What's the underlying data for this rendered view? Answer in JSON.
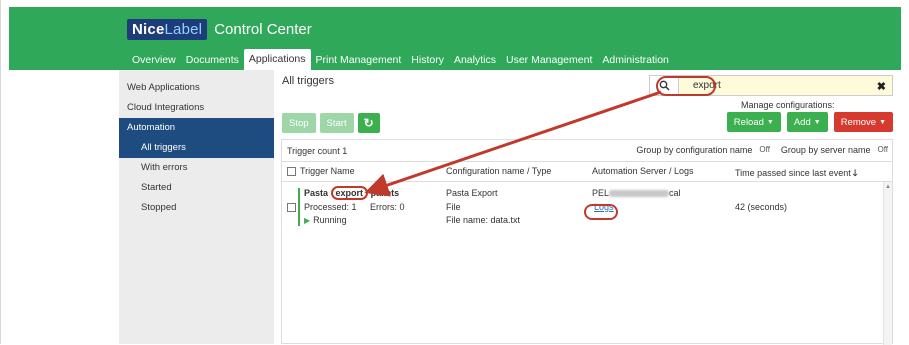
{
  "header": {
    "logo_bold": "Nice",
    "logo_light": "Label",
    "logo_suffix": "Control Center",
    "nav": [
      "Overview",
      "Documents",
      "Applications",
      "Print Management",
      "History",
      "Analytics",
      "User Management",
      "Administration"
    ]
  },
  "sidebar": {
    "items": [
      {
        "label": "Web Applications"
      },
      {
        "label": "Cloud Integrations"
      },
      {
        "label": "Automation"
      }
    ],
    "subitems": [
      {
        "label": "All triggers"
      },
      {
        "label": "With errors"
      },
      {
        "label": "Started"
      },
      {
        "label": "Stopped"
      }
    ]
  },
  "main": {
    "title": "All triggers",
    "search": {
      "value": "export",
      "clear": "✖",
      "icon": "search-icon"
    },
    "toolbar": {
      "stop": "Stop",
      "start": "Start",
      "refresh": "↻"
    },
    "manage_label": "Manage configurations:",
    "actions": {
      "reload": "Reload",
      "add": "Add",
      "remove": "Remove"
    },
    "count": "Trigger count 1",
    "group_by_config": "Group by configuration name",
    "group_by_server": "Group by server name",
    "off_label": "Off",
    "columns": {
      "name": "Trigger Name",
      "config": "Configuration name / Type",
      "server": "Automation Server / Logs",
      "time": "Time passed since last event"
    },
    "row": {
      "name_prefix": "Pasta",
      "name_match": "export",
      "name_suffix": "pallets",
      "processed": "Processed: 1",
      "errors": "Errors: 0",
      "status": "Running",
      "config_name": "Pasta Export",
      "config_type": "File",
      "config_file": "File name: data.txt",
      "server_prefix": "PEL",
      "server_suffix": "cal",
      "logs": "Logs",
      "time": "42 (seconds)"
    }
  },
  "colors": {
    "topbar": "#2fa85a",
    "selected": "#1f4c80",
    "annotation": "#c0392b"
  }
}
